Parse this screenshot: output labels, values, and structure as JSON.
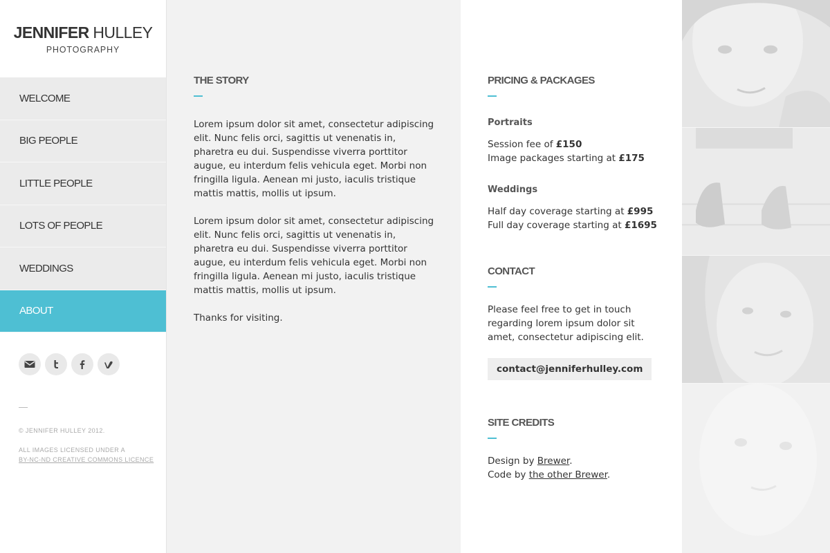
{
  "brand": {
    "first": "JENNIFER",
    "last": "HULLEY",
    "sub": "PHOTOGRAPHY"
  },
  "nav": {
    "items": [
      {
        "label": "WELCOME"
      },
      {
        "label": "BIG PEOPLE"
      },
      {
        "label": "LITTLE PEOPLE"
      },
      {
        "label": "LOTS OF PEOPLE"
      },
      {
        "label": "WEDDINGS"
      },
      {
        "label": "ABOUT",
        "active": true
      }
    ]
  },
  "social": [
    "mail-icon",
    "twitter-icon",
    "facebook-icon",
    "vimeo-icon"
  ],
  "footer": {
    "rule": "—",
    "copyright": "© JENNIFER HULLEY 2012.",
    "license_prefix": "ALL IMAGES LICENSED UNDER A",
    "license_link": "BY-NC-ND CREATIVE COMMONS LICENCE"
  },
  "story": {
    "title": "THE STORY",
    "p1": "Lorem ipsum dolor sit amet, consectetur adipiscing elit. Nunc felis orci, sagittis ut venenatis in, pharetra eu dui. Suspendisse viverra porttitor augue, eu interdum felis vehicula eget. Morbi non fringilla ligula. Aenean mi justo, iaculis tristique mattis mattis, mollis ut ipsum.",
    "p2": "Lorem ipsum dolor sit amet, consectetur adipiscing elit. Nunc felis orci, sagittis ut venenatis in, pharetra eu dui. Suspendisse viverra porttitor augue, eu interdum felis vehicula eget. Morbi non fringilla ligula. Aenean mi justo, iaculis tristique mattis mattis, mollis ut ipsum.",
    "p3": "Thanks for visiting."
  },
  "pricing": {
    "title": "PRICING & PACKAGES",
    "portraits": {
      "heading": "Portraits",
      "session_label": "Session fee of ",
      "session_price": "£150",
      "packages_label": "Image packages starting at ",
      "packages_price": "£175"
    },
    "weddings": {
      "heading": "Weddings",
      "half_label": "Half day coverage starting at ",
      "half_price": "£995",
      "full_label": "Full day coverage starting at ",
      "full_price": "£1695"
    }
  },
  "contact": {
    "title": "CONTACT",
    "text": "Please feel free to get in touch regarding lorem ipsum dolor sit amet, consectetur adipiscing elit.",
    "email": "contact@jenniferhulley.com"
  },
  "credits": {
    "title": "SITE CREDITS",
    "design_prefix": "Design by ",
    "design_link": "Brewer",
    "code_prefix": "Code by ",
    "code_link": "the other Brewer",
    "period": "."
  },
  "colors": {
    "accent": "#4ebfd3",
    "nav_bg": "#ebebeb",
    "story_bg": "#f2f2f2"
  }
}
